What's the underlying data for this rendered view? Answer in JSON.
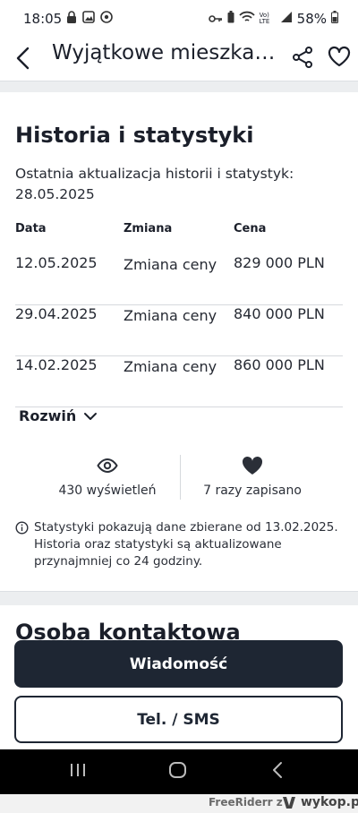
{
  "status_bar": {
    "time": "18:05",
    "battery": "58%",
    "network": "Vo) LTE"
  },
  "app_bar": {
    "title": "Wyjątkowe mieszkan…"
  },
  "history": {
    "title": "Historia i statystyki",
    "updated_text": "Ostatnia aktualizacja historii i statystyk: 28.05.2025",
    "headers": {
      "date": "Data",
      "change": "Zmiana",
      "price": "Cena"
    },
    "rows": [
      {
        "date": "12.05.2025",
        "change": "Zmiana ceny",
        "price": "829 000 PLN"
      },
      {
        "date": "29.04.2025",
        "change": "Zmiana ceny",
        "price": "840 000 PLN"
      },
      {
        "date": "14.02.2025",
        "change": "Zmiana ceny",
        "price": "860 000 PLN"
      }
    ],
    "expand_label": "Rozwiń"
  },
  "stats": {
    "views": "430 wyświetleń",
    "saves": "7 razy zapisano"
  },
  "note": "Statystyki pokazują dane zbierane od 13.02.2025. Historia oraz statystyki są aktualizowane przynajmniej co 24 godziny.",
  "contact": {
    "title": "Osoba kontaktowa"
  },
  "buttons": {
    "message": "Wiadomość",
    "phone": "Tel. / SMS"
  },
  "footer": {
    "text": "FreeRiderr z",
    "logo": "wykop.pl"
  },
  "colors": {
    "primary": "#1e2633",
    "background": "#f0f1f2"
  }
}
